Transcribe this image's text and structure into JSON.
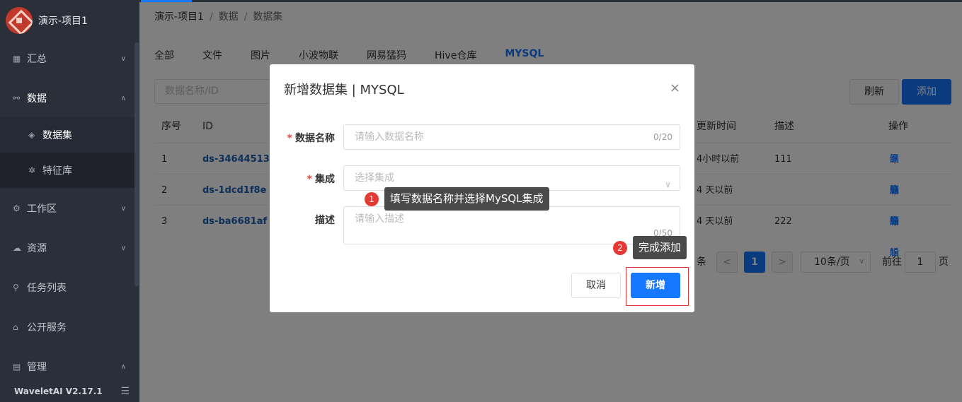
{
  "sidebar": {
    "project": "演示-项目1",
    "items": [
      {
        "label": "汇总",
        "icon": "dashboard-icon",
        "chevron": "∨"
      },
      {
        "label": "数据",
        "icon": "data-tree-icon",
        "chevron": "∧"
      },
      {
        "label": "数据集",
        "icon": "cube-icon"
      },
      {
        "label": "特征库",
        "icon": "feature-network-icon"
      },
      {
        "label": "工作区",
        "icon": "gear-icon",
        "chevron": "∨"
      },
      {
        "label": "资源",
        "icon": "cloud-icon",
        "chevron": "∨"
      },
      {
        "label": "任务列表",
        "icon": "task-flow-icon"
      },
      {
        "label": "公开服务",
        "icon": "service-icon"
      },
      {
        "label": "管理",
        "icon": "chart-icon",
        "chevron": "∧"
      }
    ],
    "version": "WaveletAI V2.17.1"
  },
  "breadcrumb": [
    "演示-项目1",
    "数据",
    "数据集"
  ],
  "tabs": [
    "全部",
    "文件",
    "图片",
    "小波物联",
    "网易猛犸",
    "Hive仓库",
    "MYSQL"
  ],
  "toolbar": {
    "search_placeholder": "数据名称/ID",
    "refresh": "刷新",
    "add": "添加"
  },
  "table": {
    "headers": {
      "index": "序号",
      "id": "ID",
      "updated": "更新时间",
      "desc": "描述",
      "ops": "操作"
    },
    "rows": [
      {
        "index": "1",
        "id": "ds-34644513",
        "updated": "4小时以前",
        "desc": "111"
      },
      {
        "index": "2",
        "id": "ds-1dcd1f8e",
        "updated": "4 天以前",
        "desc": ""
      },
      {
        "index": "3",
        "id": "ds-ba6681af",
        "updated": "4 天以前",
        "desc": "222"
      }
    ],
    "edit": "编辑",
    "delete": "删除"
  },
  "pagination": {
    "suffix_count": "条",
    "prev": "<",
    "page": "1",
    "next": ">",
    "page_size": "10条/页",
    "goto_label": "前往",
    "goto_value": "1",
    "page_unit": "页"
  },
  "modal": {
    "title": "新增数据集 | MYSQL",
    "close": "×",
    "name_label": "数据名称",
    "name_placeholder": "请输入数据名称",
    "name_count": "0/20",
    "integration_label": "集成",
    "integration_placeholder": "选择集成",
    "desc_label": "描述",
    "desc_placeholder": "请输入描述",
    "desc_count": "0/50",
    "required_mark": "*",
    "cancel": "取消",
    "submit": "新增"
  },
  "annotations": [
    {
      "number": "1",
      "text": "填写数据名称并选择MySQL集成"
    },
    {
      "number": "2",
      "text": "完成添加"
    }
  ]
}
